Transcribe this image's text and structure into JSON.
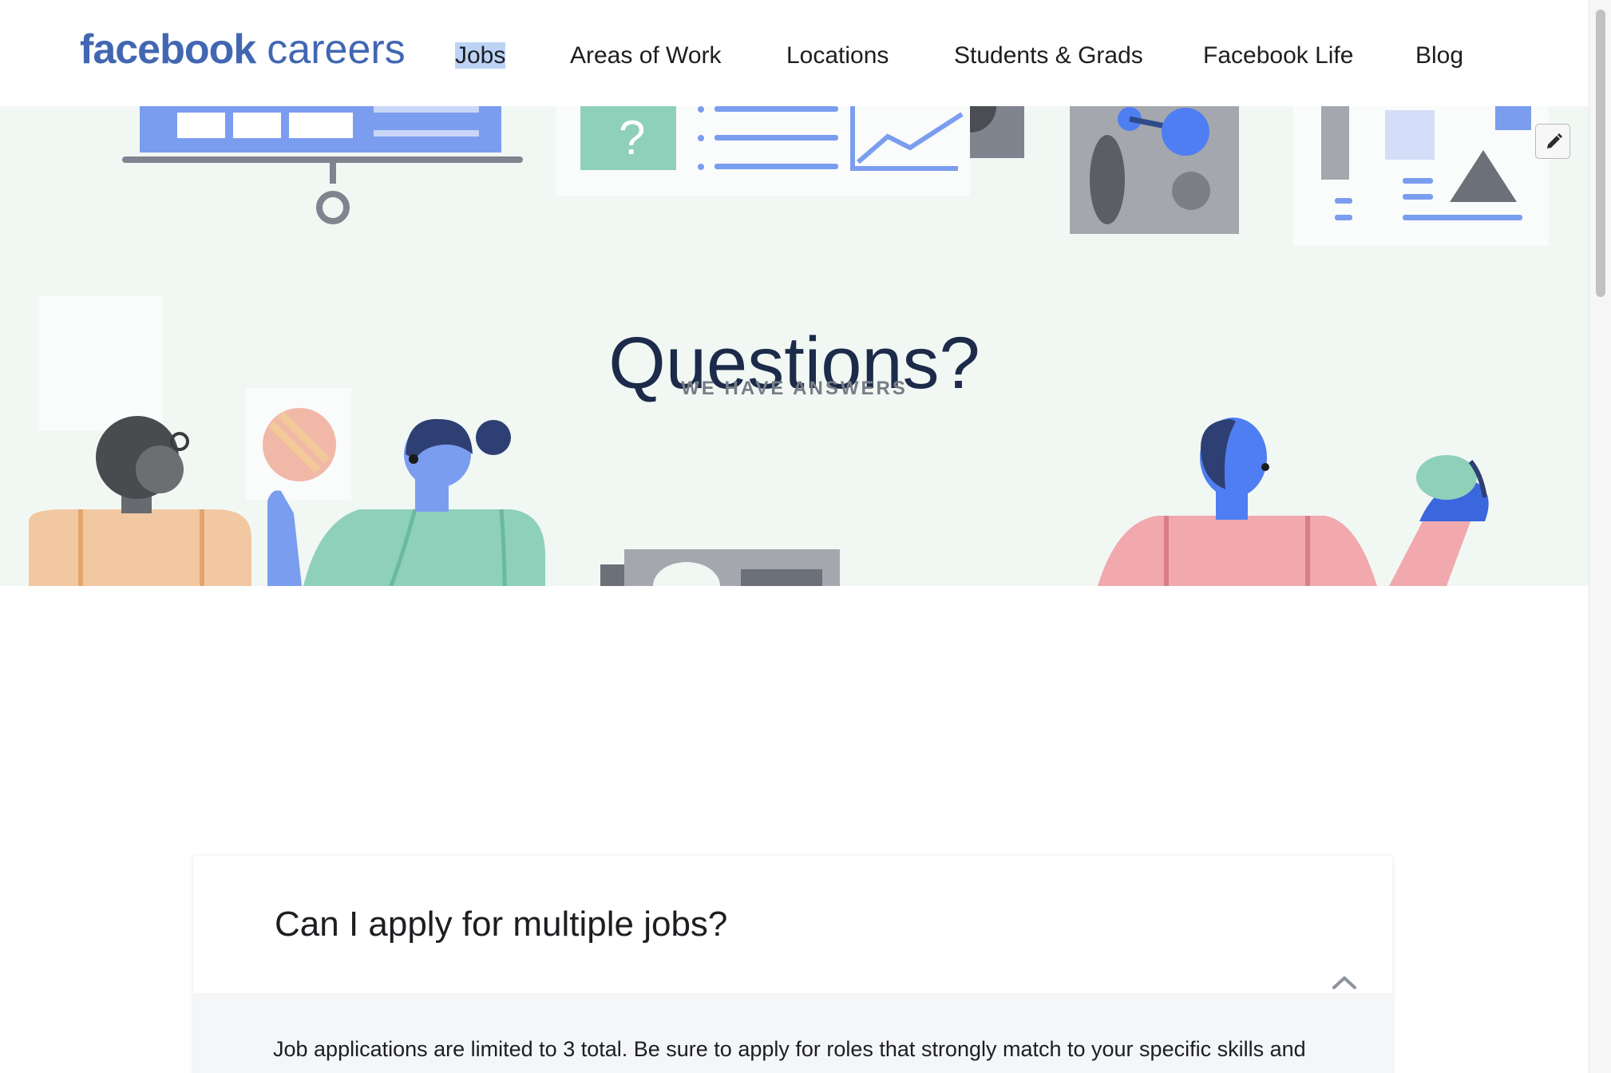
{
  "header": {
    "logo_brand": "facebook",
    "logo_sub": "careers",
    "nav": [
      {
        "label": "Jobs",
        "selected": true
      },
      {
        "label": "Areas of Work",
        "selected": false
      },
      {
        "label": "Locations",
        "selected": false
      },
      {
        "label": "Students & Grads",
        "selected": false
      },
      {
        "label": "Facebook Life",
        "selected": false
      },
      {
        "label": "Blog",
        "selected": false
      }
    ]
  },
  "hero": {
    "title": "Questions?",
    "subtitle": "WE HAVE ANSWERS",
    "background_color": "#f1f8f4"
  },
  "faq": {
    "question": "Can I apply for multiple jobs?",
    "expanded": true,
    "answer": "Job applications are limited to 3 total. Be sure to apply for roles that strongly match to your specific skills and"
  },
  "colors": {
    "brand": "#4267b2",
    "title": "#1c2b4a",
    "nav_selection": "#bcd3f5"
  },
  "icons": {
    "edit": "pencil-icon",
    "collapse": "chevron-up-icon"
  }
}
